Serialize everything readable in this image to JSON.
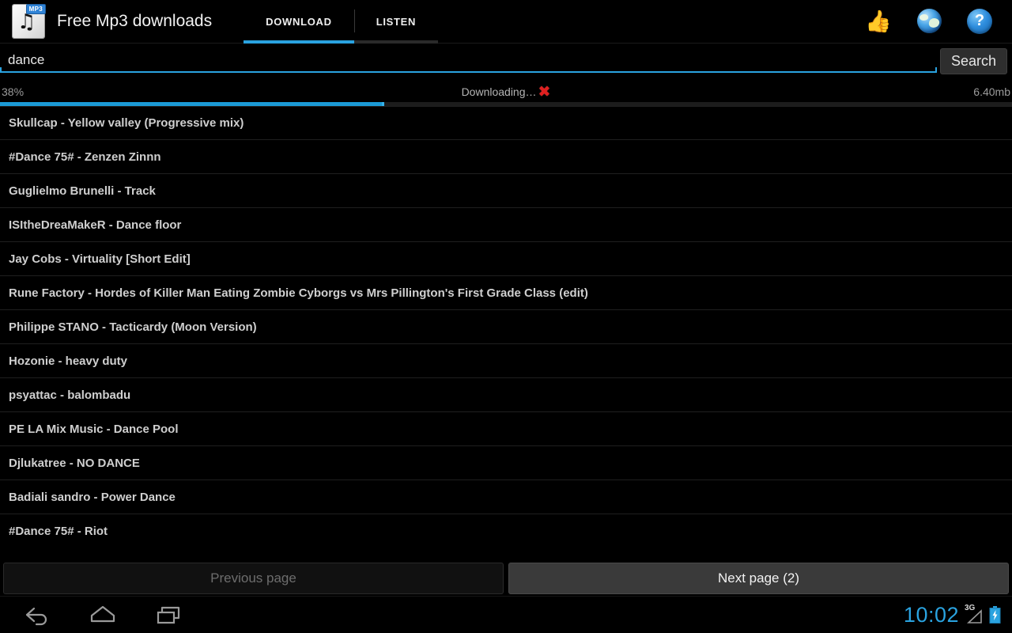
{
  "app": {
    "title": "Free Mp3 downloads",
    "icon_name": "mp3-file-icon",
    "icon_badge": "MP3"
  },
  "tabs": [
    {
      "label": "DOWNLOAD",
      "active": true
    },
    {
      "label": "LISTEN",
      "active": false
    }
  ],
  "actionbar_icons": [
    {
      "name": "thumbs-up-icon",
      "glyph": "👍"
    },
    {
      "name": "globe-icon",
      "glyph": ""
    },
    {
      "name": "help-icon",
      "glyph": "?"
    }
  ],
  "search": {
    "value": "dance",
    "placeholder": "Search",
    "button_label": "Search"
  },
  "download": {
    "percent_label": "38%",
    "percent_value": 38,
    "status_text": "Downloading…",
    "cancel_glyph": "✖",
    "size_label": "6.40mb"
  },
  "results": [
    "Skullcap - Yellow valley (Progressive mix)",
    "#Dance 75# - Zenzen Zinnn",
    "Guglielmo Brunelli - Track",
    "ISItheDreaMakeR - Dance floor",
    "Jay Cobs - Virtuality [Short Edit]",
    "Rune Factory - Hordes of Killer Man Eating Zombie Cyborgs vs Mrs Pillington's First Grade Class (edit)",
    "Philippe STANO - Tacticardy (Moon Version)",
    "Hozonie - heavy duty",
    "psyattac - balombadu",
    "PE LA Mix Music - Dance Pool",
    "Djlukatree - NO DANCE",
    "Badiali sandro - Power Dance",
    "#Dance 75# - Riot"
  ],
  "pager": {
    "previous_label": "Previous page",
    "next_label": "Next page (2)"
  },
  "system": {
    "back_icon": "back-icon",
    "home_icon": "home-icon",
    "recents_icon": "recents-icon",
    "clock": "10:02",
    "network": "3G",
    "battery_icon": "battery-charging-icon"
  },
  "colors": {
    "accent": "#2aa3e0",
    "progress_fill": "#1b9ad6",
    "cancel_red": "#e02020",
    "background": "#000000"
  }
}
